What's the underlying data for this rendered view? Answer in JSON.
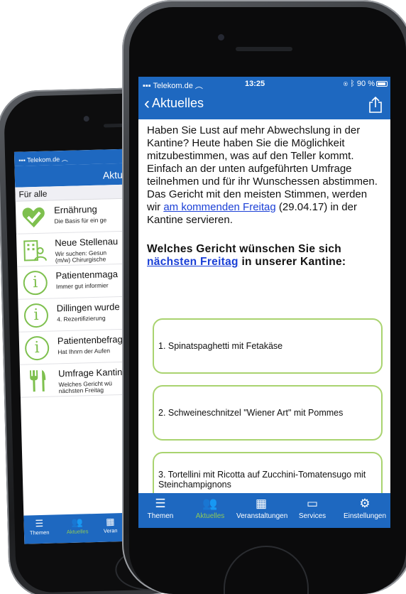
{
  "back_phone": {
    "status": {
      "carrier": "Telekom.de"
    },
    "nav_title": "Aktu",
    "section_header": "Für alle",
    "items": [
      {
        "icon": "heart-check-icon",
        "title": "Ernährung",
        "subtitle": "Die Basis für ein ge"
      },
      {
        "icon": "building-people-icon",
        "title": "Neue Stellenau",
        "subtitle": "Wir suchen: Gesun",
        "subtitle2": "(m/w) Chirurgische"
      },
      {
        "icon": "info-circle-icon",
        "title": "Patientenmaga",
        "subtitle": "Immer gut informier"
      },
      {
        "icon": "info-circle-icon",
        "title": "Dillingen wurde",
        "subtitle": "4. Rezertifizierung"
      },
      {
        "icon": "info-circle-icon",
        "title": "Patientenbefrag",
        "subtitle": "Hat Ihnrn der Aufen"
      },
      {
        "icon": "fork-knife-icon",
        "title": "Umfrage Kantin",
        "subtitle": "Welches Gericht wü",
        "subtitle2": "nächsten Freitag"
      }
    ],
    "tabs": [
      {
        "label": "Themen",
        "icon": "list-icon"
      },
      {
        "label": "Aktuelles",
        "icon": "people-icon"
      },
      {
        "label": "Veran",
        "icon": "calendar-icon"
      }
    ]
  },
  "front_phone": {
    "status": {
      "carrier": "Telekom.de",
      "time": "13:25",
      "battery": "90 %"
    },
    "nav": {
      "back_label": "Aktuelles",
      "share_icon": "share-icon"
    },
    "intro": {
      "p1": "Haben Sie Lust auf mehr Abwechslung in der Kantine? Heute haben Sie die Möglichkeit mitzubestimmen, was auf den Teller kommt. Einfach an der unten aufgeführten Umfrage teilnehmen und für ihr Wunschessen abstimmen.",
      "p2_before": "Das Gericht mit den meisten Stimmen, werden wir ",
      "p2_link": "am kommenden Freitag",
      "p2_after": " (29.04.17) in der Kantine servieren."
    },
    "question": {
      "before": "Welches Gericht wünschen Sie sich ",
      "link": "nächsten Freitag",
      "after": " in unserer Kantine:"
    },
    "options": [
      "1. Spinatspaghetti mit Fetakäse",
      "2. Schweineschnitzel \"Wiener Art\" mit Pommes",
      "3. Tortellini mit Ricotta auf Zucchini-Tomatensugo mit Steinchampignons"
    ],
    "tabs": [
      {
        "label": "Themen",
        "icon": "list-icon"
      },
      {
        "label": "Aktuelles",
        "icon": "people-icon",
        "active": true
      },
      {
        "label": "Veranstaltungen",
        "icon": "calendar-icon"
      },
      {
        "label": "Services",
        "icon": "tablet-icon"
      },
      {
        "label": "Einstellungen",
        "icon": "gear-icon"
      }
    ]
  },
  "colors": {
    "primary": "#1e68c0",
    "accent_green": "#8cc85a",
    "option_border": "#a9d36f",
    "link": "#1a3fd6"
  }
}
